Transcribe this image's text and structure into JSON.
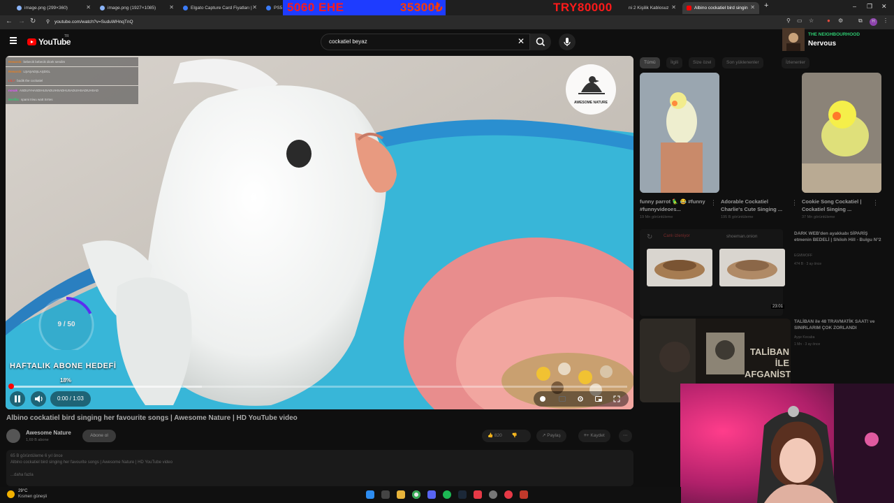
{
  "browser": {
    "tabs": [
      {
        "title": "image.png (299×360)"
      },
      {
        "title": "image.png (1927×1085)"
      },
      {
        "title": "Elgato Capture Card Fiyatları |"
      },
      {
        "title": "PS5"
      },
      {
        "title": "ni 2 Kişilik Kablosuz"
      },
      {
        "title": "Albino cockatiel bird singin"
      }
    ],
    "stream_overlay": {
      "item1": "5060 EHE",
      "item2": "35300₺",
      "item3": "TRY80000"
    },
    "url": "youtube.com/watch?v=SuduWHnqTnQ"
  },
  "youtube": {
    "logo_text": "YouTube",
    "logo_region": "TR",
    "search_value": "cockatiel beyaz",
    "video": {
      "chat": [
        {
          "user": "Rewarck",
          "user_color": "#e67e22",
          "text": "bebecik bebecik dicek sendim"
        },
        {
          "user": "Rewarck",
          "user_color": "#e67e22",
          "text": "LŞAŞADŞLAŞDGL"
        },
        {
          "user": "LİL7",
          "user_color": "#e74c3c",
          "text": "bodik the cockatiel"
        },
        {
          "user": "nosak",
          "user_color": "#e056fd",
          "text": "ASDUIYHASDIHUSADUIHSADHUSADUIHSADIUHSAD"
        },
        {
          "user": "Berillix",
          "user_color": "#2ecc71",
          "text": "spami triwu watt Srrtes"
        }
      ],
      "brand_name": "AWESOME NATURE",
      "goal": {
        "count_label": "9 / 50",
        "current": 9,
        "target": 50,
        "title": "HAFTALIK ABONE HEDEFİ",
        "percent_label": "18%"
      },
      "time_label": "0:00 / 1:03",
      "played_fraction": 0.0,
      "buffered_fraction": 0.31
    },
    "title": "Albino cockatiel bird singing her favourite songs | Awesome Nature | HD YouTube video",
    "channel": {
      "name": "Awesome Nature",
      "subs": "1,69 B abone",
      "subscribe_label": "Abone ol"
    },
    "actions": {
      "likes": "820",
      "share": "Paylaş",
      "save": "Kaydet"
    },
    "description": {
      "meta": "65 B görüntüleme  6 yıl önce",
      "text": "Albino cockatiel  bird singing her favourite songs | Awesome Nature | HD YouTube video",
      "more": "...daha fazla"
    },
    "chips": [
      "Tümü",
      "İlgili",
      "Size özel",
      "Son yüklenenler",
      "İzlenenler"
    ],
    "shorts": [
      {
        "title": "funny parrot 🦜 😂 #funny #funnyvideoes...",
        "views": "19 Mn görüntüleme"
      },
      {
        "title": "Adorable Cockatiel Charlie's Cute Singing ...",
        "views": "195 B görüntüleme"
      },
      {
        "title": "Cookie Song Cockatiel | Cockatiel Singing ...",
        "views": "37 Mn görüntüleme"
      }
    ],
    "ad": {
      "label": "Canlı izleniyor",
      "site": "shoeman.onion",
      "duration": "23:01"
    },
    "sidebar_videos": [
      {
        "title": "DARK WEB'den ayakkabı SİPARİŞ etmenin BEDELİ | Shiloh Hill - Bulgu N°2",
        "channel": "EGMWOFF",
        "meta": "474 B · 3 ay önce"
      },
      {
        "title": "TALİBAN ile 48 TRAVMATİK SAAT! ve SINIRLARIM ÇOK ZORLANDI",
        "channel": "Ayşe Kocaba",
        "meta": "1 Mn · 3 ay önce"
      }
    ],
    "taliban_thumb_text": "TALİBAN İLE AFGANİSTAN"
  },
  "sub_alert": {
    "line1": "THE NEIGHBOURHOOD",
    "line2": "Nervous"
  },
  "taskbar": {
    "temp": "29°C",
    "weather": "Kısmen güneşli"
  },
  "colors": {
    "accent": "#ff0000",
    "goal_ring": "#5b2ef0",
    "chat_bg": "#3c3c3c"
  }
}
